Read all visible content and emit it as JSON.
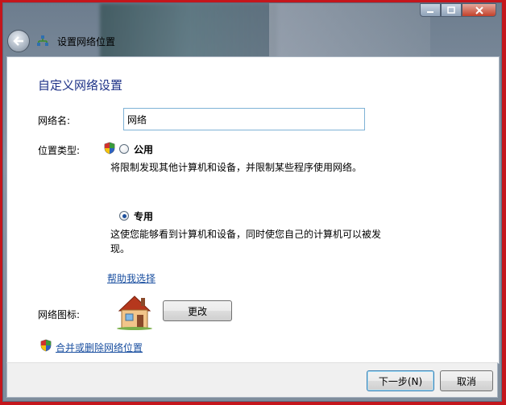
{
  "window": {
    "breadcrumb": "设置网络位置",
    "controls": {
      "minimize": "minimize-icon",
      "maximize": "maximize-icon",
      "close": "close-icon"
    }
  },
  "page": {
    "title": "自定义网络设置",
    "network_name_label": "网络名:",
    "network_name_value": "网络",
    "location_type_label": "位置类型:",
    "public": {
      "label": "公用",
      "description": "将限制发现其他计算机和设备，并限制某些程序使用网络。",
      "selected": false
    },
    "private": {
      "label": "专用",
      "description_line1": "这使您能够看到计算机和设备，同时使您自己的计算机可以被发",
      "description_line2": "现。",
      "selected": true
    },
    "help_link": "帮助我选择",
    "network_icon_label": "网络图标:",
    "change_button": "更改",
    "merge_link": "合并或删除网络位置"
  },
  "footer": {
    "next_button": "下一步(N)",
    "cancel_button": "取消"
  },
  "colors": {
    "title": "#1e3287",
    "link": "#1a4fa0",
    "outer_border": "#c4161c"
  }
}
